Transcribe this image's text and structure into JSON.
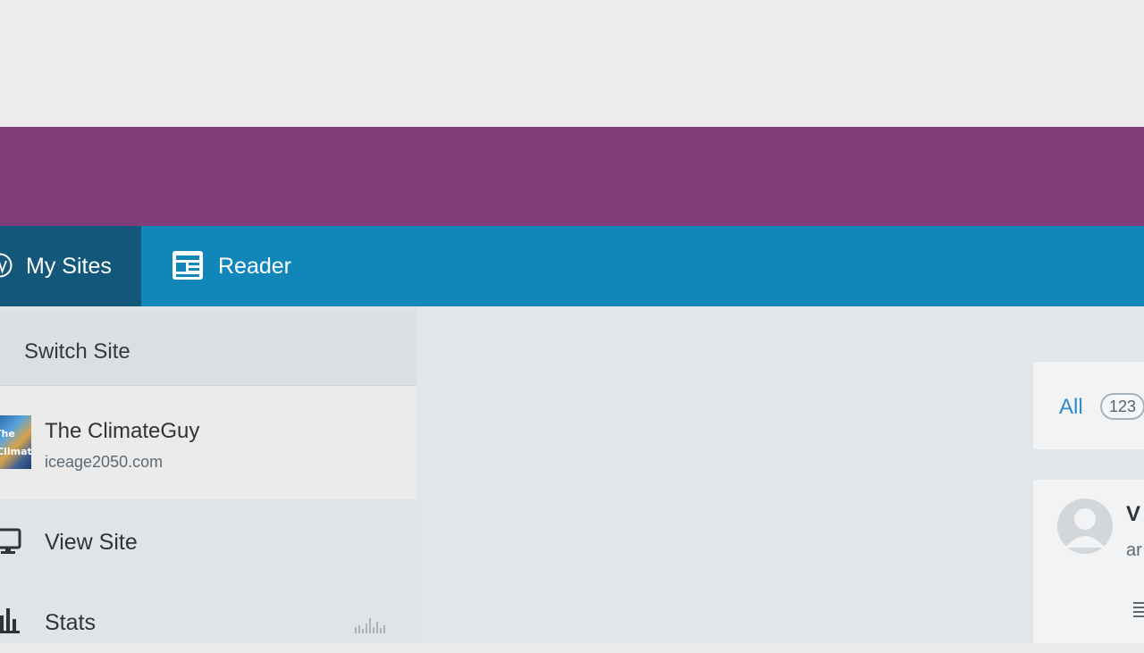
{
  "masterbar": {
    "my_sites_label": "My Sites",
    "reader_label": "Reader",
    "my_sites_icon": "wordpress-logo-icon",
    "reader_icon": "reader-icon",
    "bar_color": "#1186b8",
    "active_color": "#13587a"
  },
  "banner": {
    "color": "#7f3e79"
  },
  "sidebar": {
    "switch_site_label": "Switch Site",
    "site": {
      "title": "The ClimateGuy",
      "url": "iceage2050.com"
    },
    "items": [
      {
        "label": "View Site",
        "icon": "monitor-icon"
      },
      {
        "label": "Stats",
        "icon": "bar-chart-icon"
      }
    ]
  },
  "comments": {
    "filter_all_label": "All",
    "all_count": "123",
    "first_comment": {
      "author_partial": "V",
      "meta_partial": "ar"
    }
  }
}
